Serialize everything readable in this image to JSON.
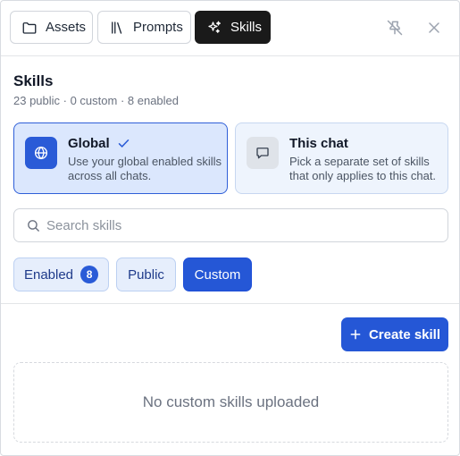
{
  "tabs": {
    "assets": "Assets",
    "prompts": "Prompts",
    "skills": "Skills"
  },
  "heading": {
    "title": "Skills",
    "subtitle": "23 public · 0 custom · 8 enabled"
  },
  "scope": {
    "global": {
      "title": "Global",
      "description": "Use your global enabled skills across all chats.",
      "selected": true
    },
    "this_chat": {
      "title": "This chat",
      "description": "Pick a separate set of skills that only applies to this chat."
    }
  },
  "search": {
    "placeholder": "Search skills",
    "value": ""
  },
  "filters": {
    "enabled": "Enabled",
    "enabled_count": "8",
    "public": "Public",
    "custom": "Custom",
    "active": "custom"
  },
  "actions": {
    "create_skill": "Create skill"
  },
  "empty_state": {
    "message": "No custom skills uploaded"
  },
  "colors": {
    "accent": "#2557d6",
    "active_tab": "#1a1a1a",
    "card_selected_bg": "#dbe7fd"
  },
  "icons": {
    "assets": "folder-icon",
    "prompts": "library-icon",
    "skills": "sparkles-icon",
    "pin": "pin-off-icon",
    "close": "close-icon",
    "global": "globe-icon",
    "this_chat": "chat-bubble-icon",
    "search": "search-icon",
    "create": "plus-icon"
  }
}
